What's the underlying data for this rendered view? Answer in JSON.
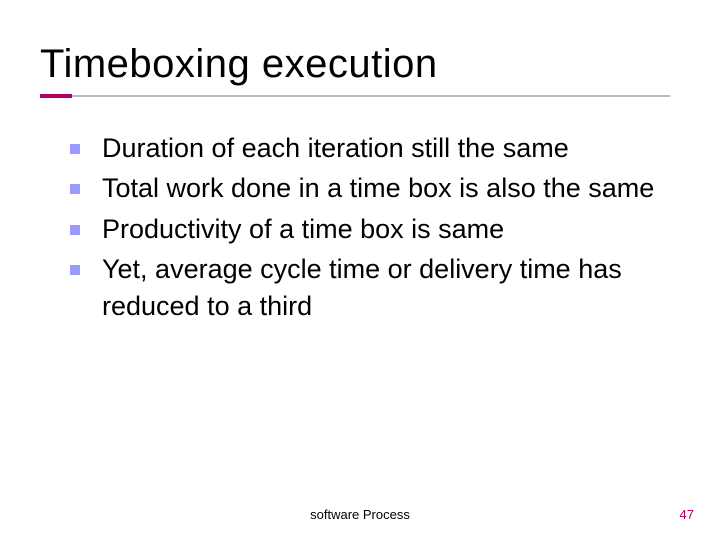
{
  "title": "Timeboxing execution",
  "bullets": [
    "Duration of each iteration still the same",
    "Total work done in a time box is also the same",
    "Productivity of a time box is same",
    "Yet, average cycle time or delivery time has reduced to a third"
  ],
  "footer": {
    "center": "software Process",
    "page": "47"
  },
  "colors": {
    "accent": "#b40065",
    "bullet": "#9a9aff",
    "underline": "#b9b9b9"
  }
}
